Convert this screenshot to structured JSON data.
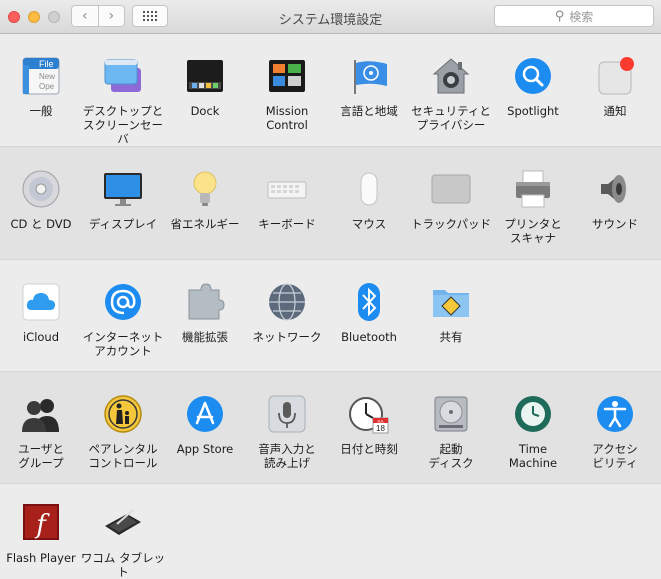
{
  "window": {
    "title": "システム環境設定"
  },
  "toolbar": {
    "back_glyph": "‹",
    "forward_glyph": "›",
    "search_placeholder": "検索",
    "search_glyph": "⚲"
  },
  "icons": {
    "general": "general-file-icon",
    "desktop": "desktop-screensaver-icon",
    "dock": "dock-icon",
    "mission": "mission-control-icon",
    "language": "un-flag-icon",
    "security": "house-lock-icon",
    "spotlight": "magnifier-icon",
    "notifications": "notification-badge-icon"
  },
  "sections": [
    {
      "items": [
        {
          "label": "一般"
        },
        {
          "label": "デスクトップと\nスクリーンセーバ"
        },
        {
          "label": "Dock"
        },
        {
          "label": "Mission\nControl"
        },
        {
          "label": "言語と地域"
        },
        {
          "label": "セキュリティと\nプライバシー"
        },
        {
          "label": "Spotlight"
        },
        {
          "label": "通知"
        }
      ]
    },
    {
      "items": [
        {
          "label": "CD と DVD"
        },
        {
          "label": "ディスプレイ"
        },
        {
          "label": "省エネルギー"
        },
        {
          "label": "キーボード"
        },
        {
          "label": "マウス"
        },
        {
          "label": "トラックパッド"
        },
        {
          "label": "プリンタと\nスキャナ"
        },
        {
          "label": "サウンド"
        }
      ]
    },
    {
      "items": [
        {
          "label": "iCloud"
        },
        {
          "label": "インターネット\nアカウント"
        },
        {
          "label": "機能拡張"
        },
        {
          "label": "ネットワーク"
        },
        {
          "label": "Bluetooth"
        },
        {
          "label": "共有"
        }
      ]
    },
    {
      "items": [
        {
          "label": "ユーザと\nグループ"
        },
        {
          "label": "ペアレンタル\nコントロール"
        },
        {
          "label": "App Store"
        },
        {
          "label": "音声入力と\n読み上げ"
        },
        {
          "label": "日付と時刻"
        },
        {
          "label": "起動\nディスク"
        },
        {
          "label": "Time\nMachine"
        },
        {
          "label": "アクセシ\nビリティ"
        }
      ]
    },
    {
      "items": [
        {
          "label": "Flash Player"
        },
        {
          "label": "ワコム タブレット"
        }
      ]
    }
  ],
  "icon_text": {
    "file": "File",
    "file_lines": [
      "New",
      "Ope"
    ],
    "calendar_month": "JUL",
    "calendar_day": "18",
    "flash": "f"
  },
  "colors": {
    "close": "#fc605c",
    "minimize": "#fdbc40",
    "accent_blue": "#1d8cf0",
    "flash_red": "#7a1010"
  }
}
